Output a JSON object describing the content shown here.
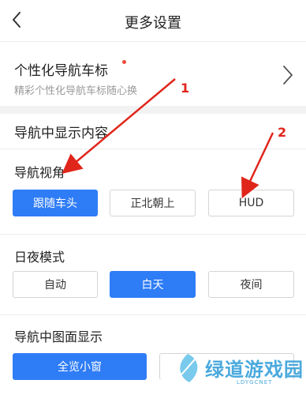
{
  "header": {
    "title": "更多设置"
  },
  "custom_car_icon": {
    "label": "个性化导航车标",
    "subtitle": "精彩个性化导航车标随心换"
  },
  "section_display": {
    "title": "导航中显示内容"
  },
  "nav_view": {
    "title": "导航视角",
    "options": [
      "跟随车头",
      "正北朝上",
      "HUD"
    ],
    "selected": "跟随车头"
  },
  "day_night": {
    "title": "日夜模式",
    "options": [
      "自动",
      "白天",
      "夜间"
    ],
    "selected": "白天"
  },
  "map_display": {
    "title": "导航中图面显示",
    "options": [
      "全览小窗"
    ],
    "selected": "全览小窗"
  },
  "annotations": {
    "marker1": "1",
    "marker2": "2",
    "arrow_color": "#e0251b"
  },
  "watermark": {
    "text": "绿道游戏园",
    "sub": "LDYGCNET"
  },
  "colors": {
    "accent": "#2f7df6",
    "red_dot": "#f04a3a"
  }
}
